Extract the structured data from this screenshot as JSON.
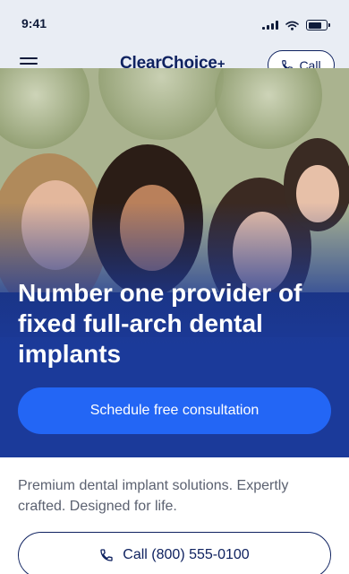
{
  "status_bar": {
    "time": "9:41",
    "icons": [
      "cellular-signal-icon",
      "wifi-icon",
      "battery-icon"
    ]
  },
  "nav": {
    "brand": "ClearChoice",
    "brand_mark": "+",
    "call_label": "Call",
    "menu_icon": "hamburger-menu-icon",
    "call_icon": "phone-icon"
  },
  "hero": {
    "title": "Number one provider of fixed full-arch dental implants",
    "cta_label": "Schedule free consultation",
    "image": "group-of-smiling-women-photo"
  },
  "body": {
    "tagline": "Premium dental implant solutions. Expertly crafted. Designed for life.",
    "phone_label": "Call (800) 555-0100",
    "phone_icon": "phone-icon"
  },
  "colors": {
    "brand_navy": "#0f2260",
    "accent_blue": "#2366f5",
    "hero_blue": "#1b3a9a",
    "nav_bg": "#e9edf4"
  }
}
